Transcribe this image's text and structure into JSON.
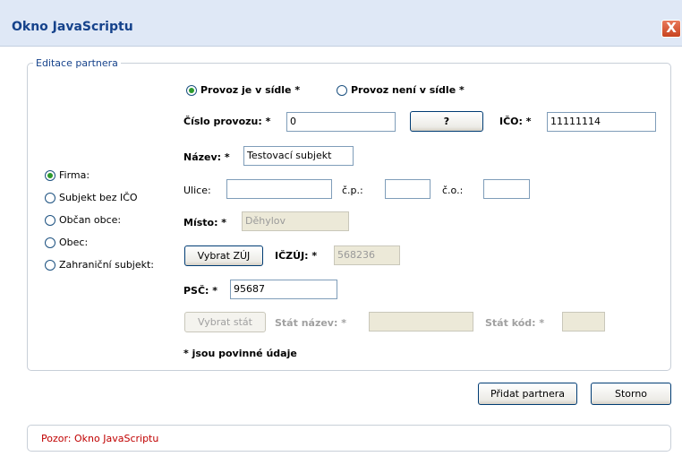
{
  "window": {
    "title": "Okno JavaScriptu",
    "close_label": "X"
  },
  "form": {
    "legend": "Editace partnera",
    "provoz_options": [
      "Provoz je v sídle *",
      "Provoz není v sídle *"
    ],
    "provoz_selected": 0,
    "type_options": [
      "Firma:",
      "Subjekt bez IČO",
      "Občan obce:",
      "Obec:",
      "Zahraniční subjekt:"
    ],
    "type_selected": 0,
    "cislo_provozu": {
      "label": "Číslo provozu: *",
      "value": "0"
    },
    "lookup_button": "?",
    "ico": {
      "label": "IČO: *",
      "value": "11111114"
    },
    "nazev": {
      "label": "Název: *",
      "value": "Testovací subjekt"
    },
    "ulice": {
      "label": "Ulice:",
      "value": ""
    },
    "cp": {
      "label": "č.p.:",
      "value": ""
    },
    "co": {
      "label": "č.o.:",
      "value": ""
    },
    "misto": {
      "label": "Místo: *",
      "value": "Děhylov"
    },
    "vybrat_zuj_button": "Vybrat ZÚJ",
    "iczuj": {
      "label": "IČZÚJ: *",
      "value": "568236"
    },
    "psc": {
      "label": "PSČ: *",
      "value": "95687"
    },
    "vybrat_stat_button": "Vybrat stát",
    "stat_nazev": {
      "label": "Stát název: *",
      "value": ""
    },
    "stat_kod": {
      "label": "Stát kód: *",
      "value": ""
    },
    "required_note": "* jsou povinné údaje"
  },
  "actions": {
    "add_label": "Přidat partnera",
    "cancel_label": "Storno"
  },
  "status": {
    "message": "Pozor: Okno JavaScriptu",
    "color": "#c00000"
  },
  "colors": {
    "title": "#15428b",
    "radio_dot": "#2d9a2d",
    "close": "#c7431f"
  }
}
